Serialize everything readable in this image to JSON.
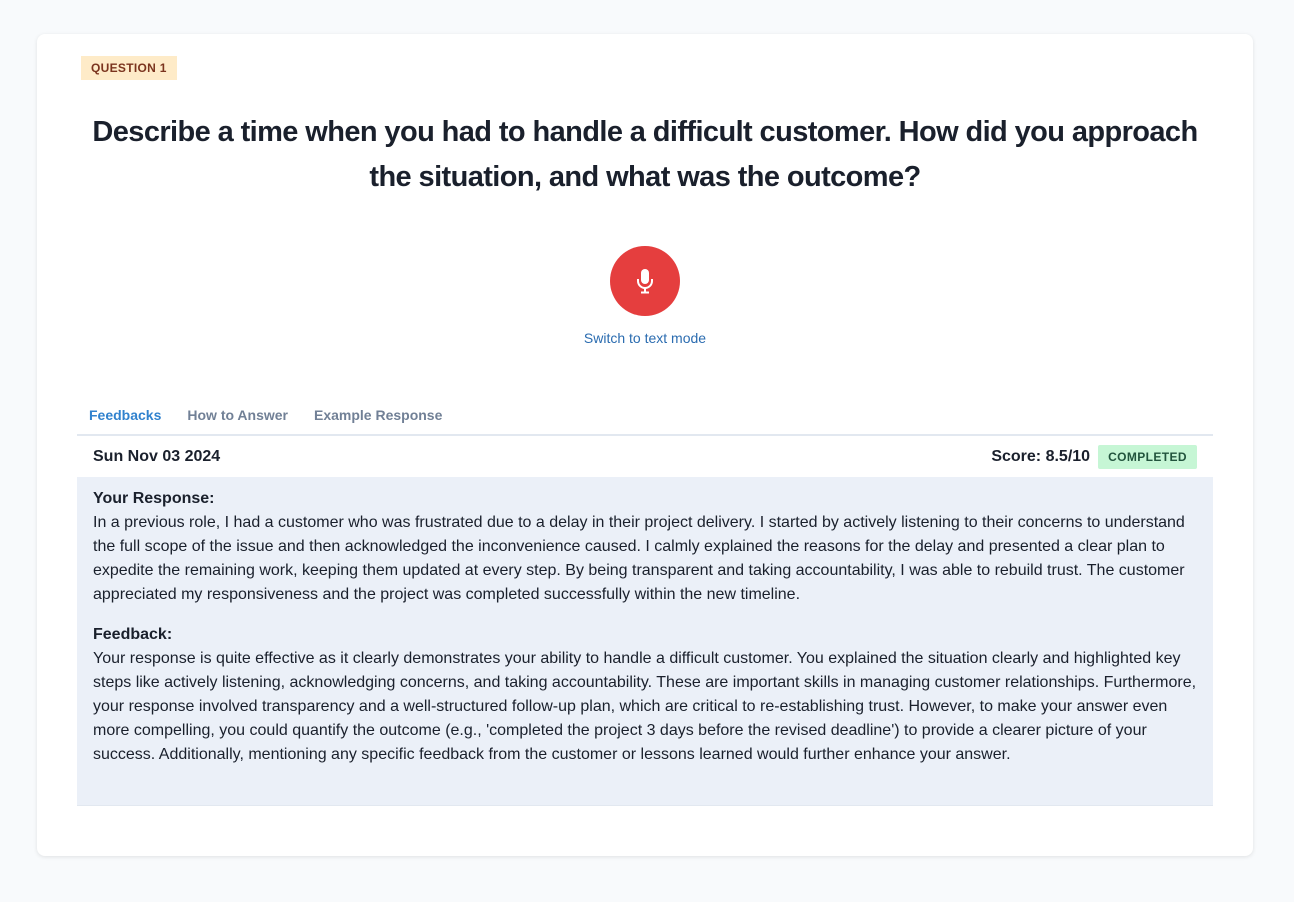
{
  "question": {
    "badge": "QUESTION 1",
    "title": "Describe a time when you had to handle a difficult customer. How did you approach the situation, and what was the outcome?"
  },
  "recorder": {
    "icon": "microphone-icon",
    "button_color": "#e53e3e",
    "switch_label": "Switch to text mode"
  },
  "tabs": [
    {
      "label": "Feedbacks",
      "active": true
    },
    {
      "label": "How to Answer",
      "active": false
    },
    {
      "label": "Example Response",
      "active": false
    }
  ],
  "result": {
    "date": "Sun Nov 03 2024",
    "score": "Score: 8.5/10",
    "status": "COMPLETED",
    "response_label": "Your Response:",
    "response_text": "In a previous role, I had a customer who was frustrated due to a delay in their project delivery. I started by actively listening to their concerns to understand the full scope of the issue and then acknowledged the inconvenience caused. I calmly explained the reasons for the delay and presented a clear plan to expedite the remaining work, keeping them updated at every step. By being transparent and taking accountability, I was able to rebuild trust. The customer appreciated my responsiveness and the project was completed successfully within the new timeline.",
    "feedback_label": "Feedback:",
    "feedback_text": "Your response is quite effective as it clearly demonstrates your ability to handle a difficult customer. You explained the situation clearly and highlighted key steps like actively listening, acknowledging concerns, and taking accountability. These are important skills in managing customer relationships. Furthermore, your response involved transparency and a well-structured follow-up plan, which are critical to re-establishing trust. However, to make your answer even more compelling, you could quantify the outcome (e.g., 'completed the project 3 days before the revised deadline') to provide a clearer picture of your success. Additionally, mentioning any specific feedback from the customer or lessons learned would further enhance your answer."
  }
}
